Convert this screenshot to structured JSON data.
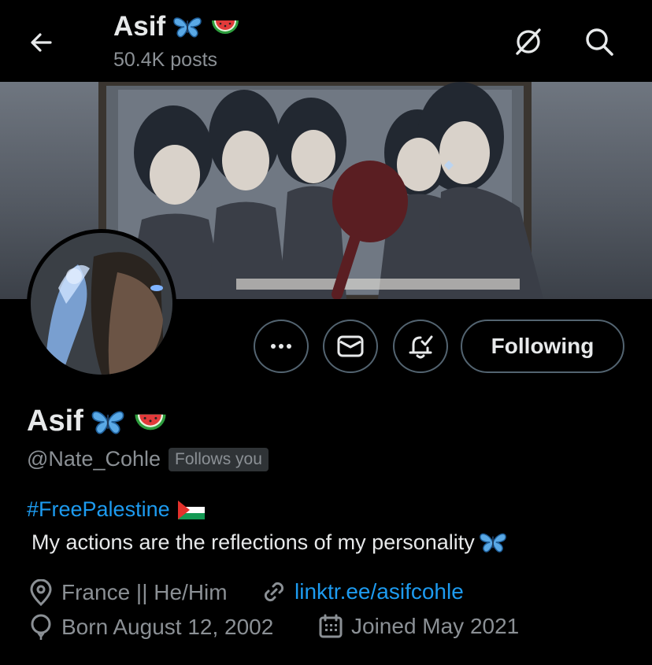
{
  "header": {
    "title": "Asif",
    "posts": "50.4K posts",
    "emojis": [
      "butterfly-icon",
      "watermelon-icon"
    ]
  },
  "actions": {
    "more": "more-options",
    "message": "message",
    "notify": "notifications",
    "follow_label": "Following"
  },
  "profile": {
    "name": "Asif",
    "handle": "@Nate_Cohle",
    "follows_you": "Follows you",
    "bio_hashtag": "#FreePalestine",
    "bio_text": "My actions are the reflections of my personality",
    "location": "France || He/Him",
    "link": "linktr.ee/asifcohle",
    "birthday": "Born August 12, 2002",
    "joined": "Joined May 2021"
  },
  "colors": {
    "background": "#000000",
    "text": "#e7e9ea",
    "secondary": "#8b9095",
    "link": "#1d9bf0",
    "border": "#536471"
  }
}
